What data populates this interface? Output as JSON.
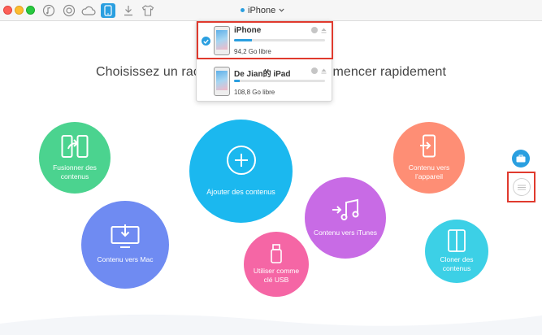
{
  "toolbar": {
    "device_selector": "iPhone",
    "icons": [
      "music-icon",
      "itunes-icon",
      "cloud-icon",
      "device-icon",
      "download-icon",
      "tshirt-icon"
    ]
  },
  "page": {
    "title": "Choisissez un raccou",
    "title_suffix": "mmencer rapidement"
  },
  "dropdown": {
    "devices": [
      {
        "name": "iPhone",
        "free": "94,2 Go libre",
        "usage": 0.2,
        "selected": true
      },
      {
        "name": "De Jian的 iPad",
        "free": "108,8 Go libre",
        "usage": 0.06,
        "selected": false
      }
    ]
  },
  "actions": {
    "merge": "Fusionner des contenus",
    "add": "Ajouter des contenus",
    "to_device": "Contenu vers l’appareil",
    "to_mac": "Contenu vers Mac",
    "to_itunes": "Contenu vers iTunes",
    "usb": "Utiliser comme clé USB",
    "clone": "Cloner des contenus"
  },
  "colors": {
    "accent": "#2a9fe0",
    "highlight": "#e03a2e",
    "merge": "#4bd38f",
    "add": "#1bb8ef",
    "to_device": "#fe8e75",
    "to_mac": "#6f8bf2",
    "to_itunes": "#c86be5",
    "usb": "#f566a5",
    "clone": "#3cd0e6"
  }
}
